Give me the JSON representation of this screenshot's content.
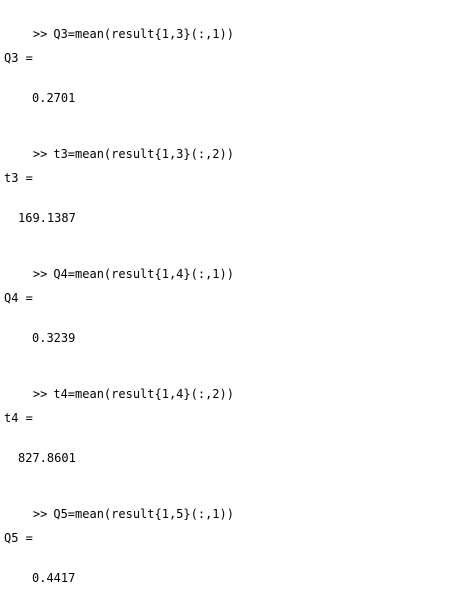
{
  "console": {
    "prompt_symbol": ">>",
    "entries": [
      {
        "command": "Q3=mean(result{1,3}(:,1))",
        "var_label": "Q3 =",
        "value": "0.2701"
      },
      {
        "command": "t3=mean(result{1,3}(:,2))",
        "var_label": "t3 =",
        "value": "169.1387"
      },
      {
        "command": "Q4=mean(result{1,4}(:,1))",
        "var_label": "Q4 =",
        "value": "0.3239"
      },
      {
        "command": "t4=mean(result{1,4}(:,2))",
        "var_label": "t4 =",
        "value": "827.8601"
      },
      {
        "command": "Q5=mean(result{1,5}(:,1))",
        "var_label": "Q5 =",
        "value": "0.4417"
      }
    ]
  }
}
